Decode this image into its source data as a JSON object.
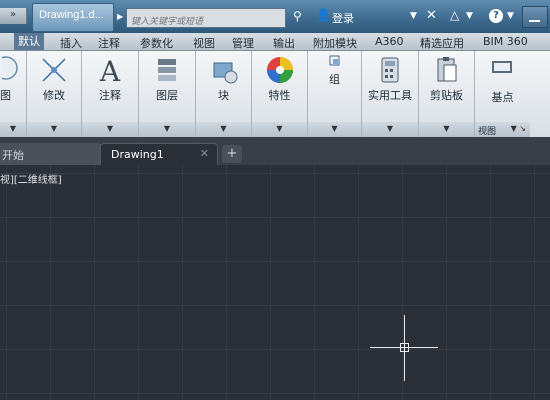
{
  "titlebar": {
    "file_tab": "Drawing1.d...",
    "search_placeholder": "键入关键字或短语",
    "login": "登录"
  },
  "ribbon_tabs": [
    "默认",
    "插入",
    "注释",
    "参数化",
    "视图",
    "管理",
    "输出",
    "附加模块",
    "A360",
    "精选应用",
    "BIM 360"
  ],
  "ribbon_panels": {
    "draw": "图",
    "modify": "修改",
    "annotate": "注释",
    "layers": "图层",
    "block": "块",
    "properties": "特性",
    "group": "组",
    "utilities": "实用工具",
    "clipboard": "剪贴板",
    "base": "基点",
    "view": "视图"
  },
  "doc_tabs": {
    "start": "开始",
    "drawing": "Drawing1"
  },
  "viewport_label": "视][二维线框]",
  "colors": {
    "canvas": "#2b2f38",
    "titlebar": "#3d6a8e",
    "ribbon_active_tab": "#5b7894"
  }
}
